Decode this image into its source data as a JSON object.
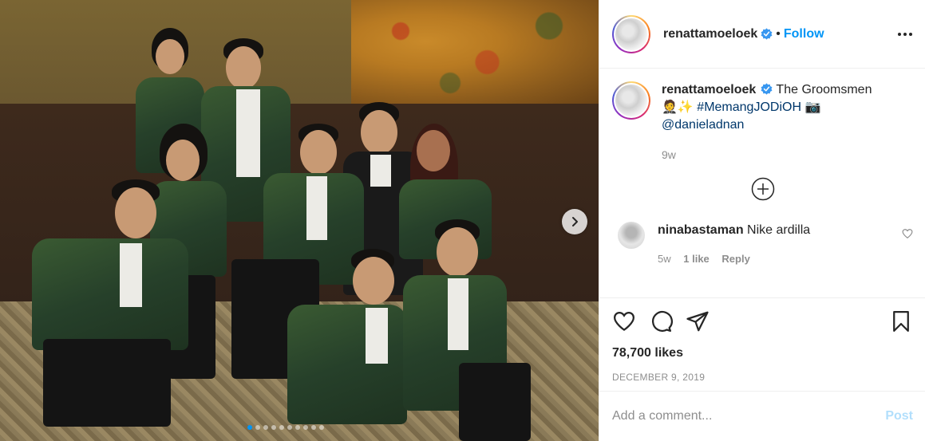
{
  "post": {
    "author": "renattamoeloek",
    "follow_label": "Follow",
    "separator": "•",
    "caption": {
      "text": "The Groomsmen",
      "emoji": "🤵✨",
      "hashtag": "#MemangJODiOH",
      "camera_emoji": "📷",
      "mention": "@danieladnan"
    },
    "caption_age": "9w",
    "comments": [
      {
        "user": "ninabastaman",
        "text": "Nike ardilla",
        "age": "5w",
        "likes": "1 like",
        "reply_label": "Reply"
      }
    ],
    "likes": "78,700 likes",
    "date": "DECEMBER 9, 2019",
    "add_comment_placeholder": "Add a comment...",
    "post_label": "Post"
  },
  "carousel": {
    "slides": 10,
    "active_index": 0
  },
  "icons": {
    "verified": "verified-badge-icon",
    "more": "more-options-icon",
    "load_more": "plus-circle-icon",
    "like": "heart-icon",
    "comment": "comment-icon",
    "share": "share-icon",
    "save": "bookmark-icon",
    "next": "chevron-right-icon"
  },
  "colors": {
    "link": "#0095f6",
    "hashtag": "#00376b",
    "muted": "#8e8e8e",
    "post_disabled": "#b2dffc"
  }
}
